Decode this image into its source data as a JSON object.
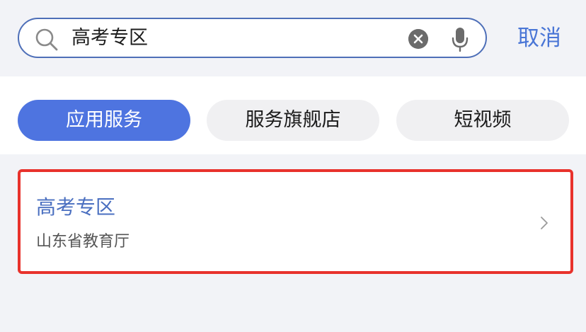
{
  "search": {
    "value": "高考专区",
    "cancel_label": "取消",
    "icons": {
      "search": "search-icon",
      "clear": "clear-icon",
      "mic": "microphone-icon"
    },
    "accent_color": "#4a76d6"
  },
  "tabs": [
    {
      "label": "应用服务",
      "active": true
    },
    {
      "label": "服务旗舰店",
      "active": false
    },
    {
      "label": "短视频",
      "active": false
    }
  ],
  "results": [
    {
      "title": "高考专区",
      "subtitle": "山东省教育厅",
      "highlight_color": "#e8322c",
      "trailing_icon": "chevron-right-icon"
    }
  ]
}
